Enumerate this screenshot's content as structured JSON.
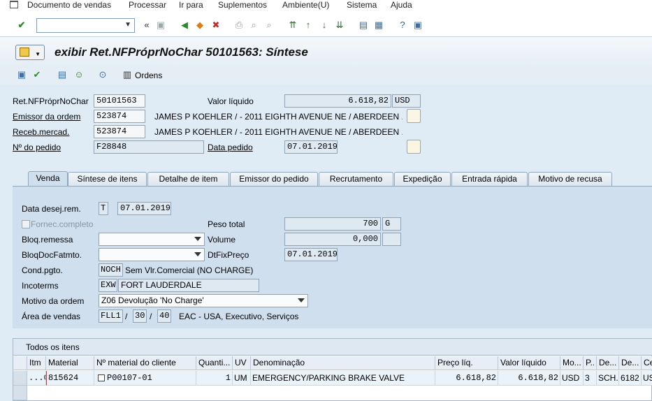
{
  "menu": [
    "Documento de vendas",
    "Processar",
    "Ir para",
    "Suplementos",
    "Ambiente(U)",
    "Sistema",
    "Ajuda"
  ],
  "title": "exibir Ret.NFPróprNoChar 50101563: Síntese",
  "app_toolbar": {
    "ordens_label": "Ordens"
  },
  "header": {
    "ret_label": "Ret.NFPróprNoChar",
    "ret_value": "50101563",
    "valor_liquido_label": "Valor líquido",
    "valor_liquido_value": "6.618,82",
    "valor_liquido_currency": "USD",
    "emissor_label": "Emissor da ordem",
    "emissor_value": "523874",
    "emissor_text": "JAMES P KOEHLER / - 2011 EIGHTH AVENUE NE / ABERDEEN ...",
    "receb_label": "Receb.mercad.",
    "receb_value": "523874",
    "receb_text": "JAMES P KOEHLER / - 2011 EIGHTH AVENUE NE / ABERDEEN ...",
    "pedido_label": "Nº do pedido",
    "pedido_value": "F28848",
    "data_pedido_label": "Data pedido",
    "data_pedido_value": "07.01.2019"
  },
  "tabs": [
    "Venda",
    "Síntese de itens",
    "Detalhe de item",
    "Emissor do pedido",
    "Recrutamento",
    "Expedição",
    "Entrada rápida",
    "Motivo de recusa"
  ],
  "venda": {
    "data_desej_label": "Data desej.rem.",
    "data_desej_type": "T",
    "data_desej_value": "07.01.2019",
    "fornec_label": "Fornec.completo",
    "peso_label": "Peso total",
    "peso_value": "700",
    "peso_unit": "G",
    "bloq_remessa_label": "Bloq.remessa",
    "volume_label": "Volume",
    "volume_value": "0,000",
    "bloq_doc_label": "BloqDocFatmto.",
    "dtfix_label": "DtFixPreço",
    "dtfix_value": "07.01.2019",
    "cond_label": "Cond.pgto.",
    "cond_value": "NOCH",
    "cond_text": "Sem Vlr.Comercial (NO CHARGE)",
    "incoterms_label": "Incoterms",
    "incoterms_value": "EXW",
    "incoterms_text": "FORT LAUDERDALE",
    "motivo_label": "Motivo da ordem",
    "motivo_value": "Z06 Devolução 'No Charge'",
    "area_label": "Área de vendas",
    "area_org": "FLL1",
    "area_sep1": "/",
    "area_canal": "30",
    "area_sep2": "/",
    "area_setor": "40",
    "area_text": "EAC - USA, Executivo, Serviços"
  },
  "items": {
    "title": "Todos os itens",
    "columns": [
      "Itm",
      "Material",
      "Nº material do cliente",
      "Quanti...",
      "UV",
      "Denominação",
      "Preço líq.",
      "Valor líquido",
      "Mo...",
      "P..",
      "De...",
      "De...",
      "Ce"
    ],
    "rows": [
      [
        "...00",
        "815624",
        "P00107-01",
        "1",
        "UM",
        "EMERGENCY/PARKING BRAKE VALVE",
        "6.618,82",
        "6.618,82",
        "USD",
        "3",
        "SCH...",
        "6182",
        "US"
      ]
    ]
  }
}
